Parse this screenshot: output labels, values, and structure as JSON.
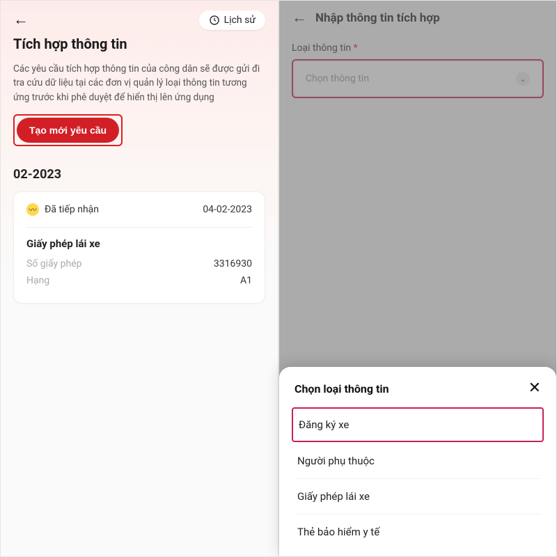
{
  "left": {
    "history_label": "Lịch sử",
    "title": "Tích hợp thông tin",
    "description": "Các yêu cầu tích hợp thông tin của công dân sẽ được gửi đi tra cứu dữ liệu tại các đơn vị quản lý loại thông tin tương ứng trước khi phê duyệt để hiển thị lên ứng dụng",
    "cta": "Tạo mới yêu cầu",
    "month": "02-2023",
    "card": {
      "status": "Đã tiếp nhận",
      "date": "04-02-2023",
      "title": "Giấy phép lái xe",
      "rows": [
        {
          "label": "Số giấy phép",
          "value": "3316930"
        },
        {
          "label": "Hạng",
          "value": "A1"
        }
      ]
    }
  },
  "right": {
    "title": "Nhập thông tin tích hợp",
    "field_label": "Loại thông tin",
    "required_mark": "*",
    "select_placeholder": "Chọn thông tin",
    "sheet": {
      "title": "Chọn loại thông tin",
      "options": [
        "Đăng ký xe",
        "Người phụ thuộc",
        "Giấy phép lái xe",
        "Thẻ bảo hiểm y tế"
      ]
    }
  }
}
